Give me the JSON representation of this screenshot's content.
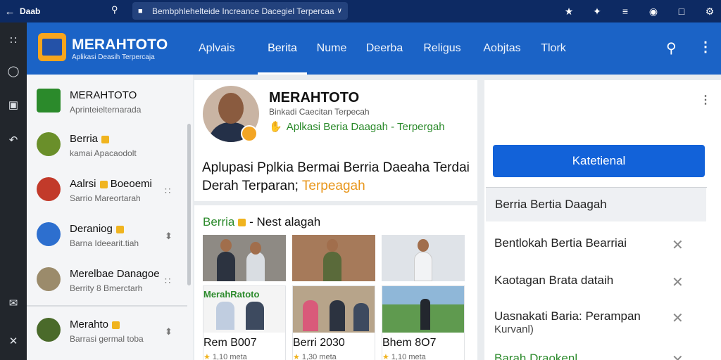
{
  "browser": {
    "site_name": "Daab",
    "url": "Bembphlehelteide Increance Dacegiel Terpercaa"
  },
  "rail": {
    "icons": [
      "apps-icon",
      "circle-icon",
      "window-icon",
      "hook-icon",
      "mail-icon",
      "crossing-icon"
    ]
  },
  "header": {
    "brand": "MERAHTOTO",
    "brand_sub": "Aplikasi Deasih Terpercaja",
    "tabs": [
      {
        "label": "Aplvais",
        "active": false
      },
      {
        "label": "Berita",
        "active": true
      },
      {
        "label": "Nume",
        "active": false
      },
      {
        "label": "Deerba",
        "active": false
      },
      {
        "label": "Religus",
        "active": false
      },
      {
        "label": "Aobjtas",
        "active": false
      },
      {
        "label": "Tlork",
        "active": false
      }
    ]
  },
  "list": {
    "items": [
      {
        "name": "MERAHTOTO",
        "sub": "Aprinteielternarada",
        "badge": false,
        "color": "#2b8a2b"
      },
      {
        "name": "Berria",
        "sub": "kamai Apacaodolt",
        "badge": true,
        "color": "#6a8f2a"
      },
      {
        "name": "Aalrsi",
        "name2": "Boeoemi",
        "sub": "Sarrio Mareortarah",
        "badge": true,
        "color": "#c23a2a"
      },
      {
        "name": "Deraniog",
        "sub": "Barna Ideearit.tiah",
        "badge": true,
        "color": "#2d6fcf"
      },
      {
        "name": "Merelbae Danagoe",
        "sub": "Berrity 8 Bmerctarh",
        "badge": false,
        "color": "#9b8b6b"
      },
      {
        "name": "Merahto",
        "sub": "Barrasi germal toba",
        "badge": true,
        "color": "#4a6a2a"
      }
    ]
  },
  "profile": {
    "title": "MERAHTOTO",
    "subtitle": "Binkadi Caecitan Terpecah",
    "tagline": "Aplkasi Beria Daagah - Terpergah",
    "description": "Aplupasi Pplkia Bermai Berria Daeaha Terdai Derah Terparan;",
    "description_highlight": "Terpeagah"
  },
  "news": {
    "heading_green": "Berria",
    "heading_rest": "- Nest alagah",
    "cards": [
      {
        "title": "Rem B007",
        "meta": "1,10 meta"
      },
      {
        "title": "Berri 2030",
        "meta": "1,30 meta"
      },
      {
        "title": "Bhem 8O7",
        "meta": "1,10 meta"
      }
    ],
    "card1_banner": "MerahRatoto"
  },
  "right": {
    "button_label": "Katetienal",
    "header_item": "Berria Bertia Daagah",
    "items": [
      {
        "label": "Bentlokah Bertia Bearriai",
        "sub": ""
      },
      {
        "label": "Kaotagan Brata dataih",
        "sub": ""
      },
      {
        "label": "Uasnakati Baria: Perampan",
        "sub": "Kurvanl)"
      },
      {
        "label": "Barah Draokenl",
        "sub": ""
      }
    ]
  }
}
